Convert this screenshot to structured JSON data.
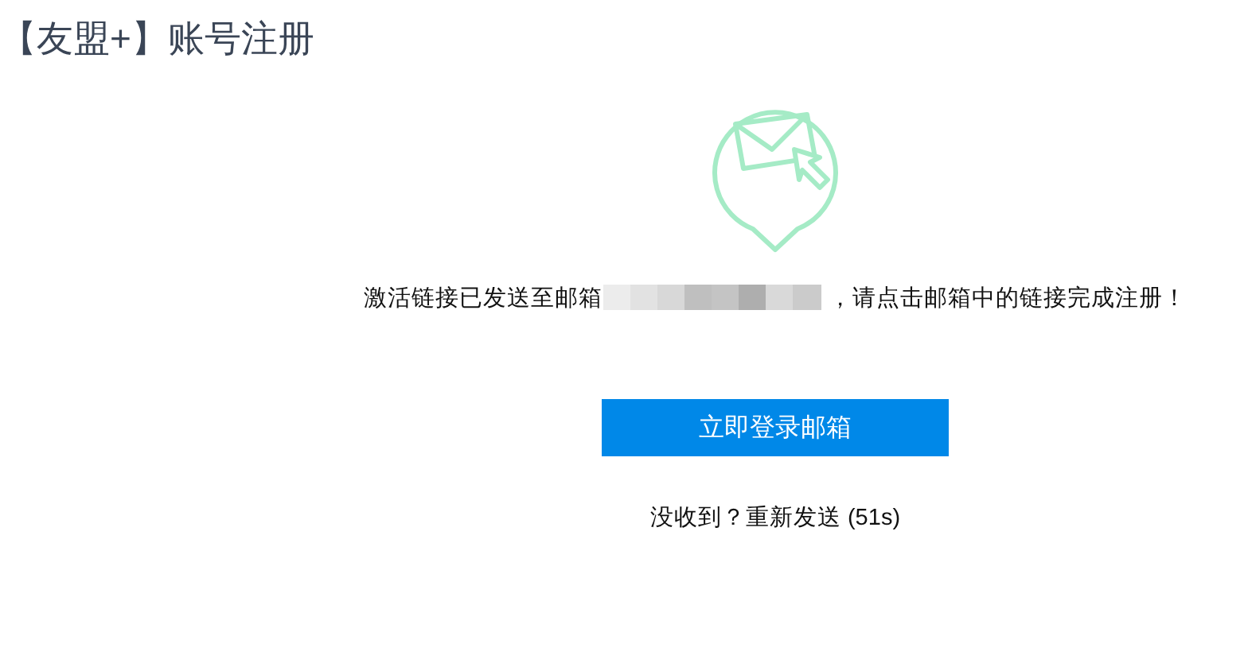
{
  "page_title": "【友盟+】账号注册",
  "message": {
    "before": "激活链接已发送至邮箱",
    "after": "，请点击邮箱中的链接完成注册！"
  },
  "primary_button": "立即登录邮箱",
  "resend": "没收到？重新发送 (51s)"
}
